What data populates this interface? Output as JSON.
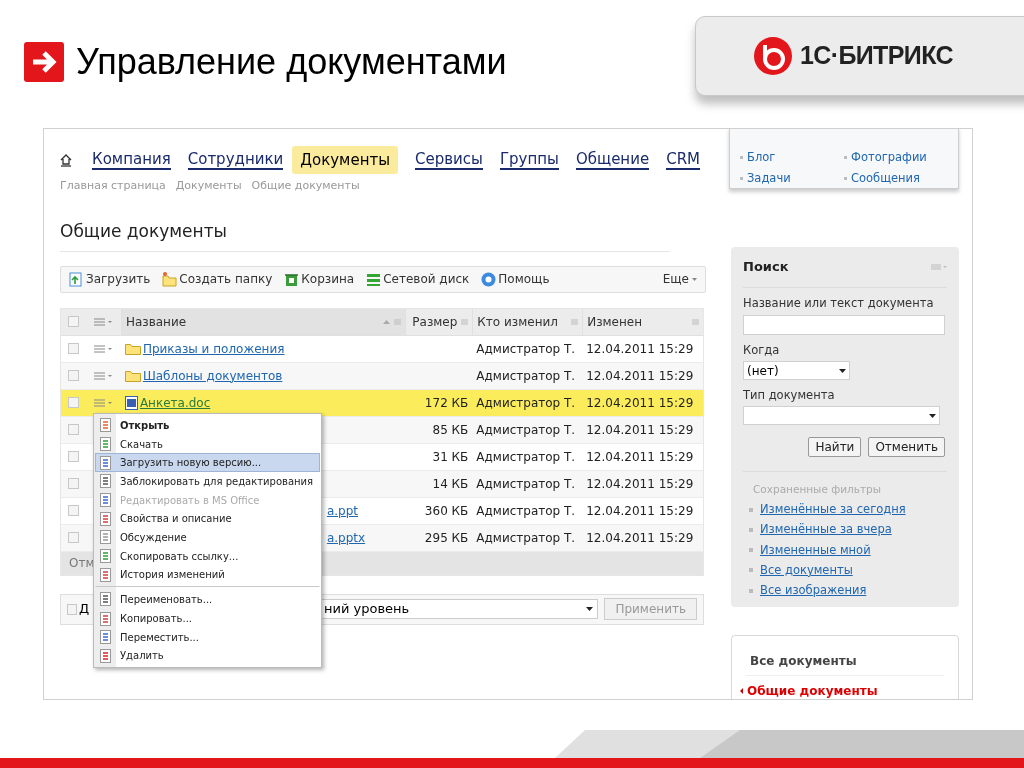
{
  "slide": {
    "title": "Управление документами",
    "logo_text": "1С·БИТРИКС"
  },
  "nav": [
    {
      "label": "Компания",
      "selected": false
    },
    {
      "label": "Сотрудники",
      "selected": false
    },
    {
      "label": "Документы",
      "selected": true
    },
    {
      "label": "Сервисы",
      "selected": false
    },
    {
      "label": "Группы",
      "selected": false
    },
    {
      "label": "Общение",
      "selected": false
    },
    {
      "label": "CRM",
      "selected": false
    }
  ],
  "breadcrumb": [
    "Главная страница",
    "Документы",
    "Общие документы"
  ],
  "page_title": "Общие документы",
  "toolbar": {
    "items": [
      "Загрузить",
      "Создать папку",
      "Корзина",
      "Сетевой диск",
      "Помощь"
    ],
    "more": "Еще"
  },
  "table": {
    "all_checked": false,
    "columns": [
      {
        "label": "Название"
      },
      {
        "label": "Размер"
      },
      {
        "label": "Кто изменил"
      },
      {
        "label": "Изменен"
      }
    ],
    "rows": [
      {
        "kind": "folder",
        "name": "Приказы и положения",
        "size": "",
        "author": "Адмистратор Т.",
        "modified": "12.04.2011 15:29",
        "selected": false,
        "checked": false
      },
      {
        "kind": "folder",
        "name": "Шаблоны документов",
        "size": "",
        "author": "Адмистратор Т.",
        "modified": "12.04.2011 15:29",
        "selected": false,
        "checked": false
      },
      {
        "kind": "doc",
        "name": "Анкета.doc",
        "size": "172 КБ",
        "author": "Адмистратор Т.",
        "modified": "12.04.2011 15:29",
        "selected": true,
        "checked": false
      },
      {
        "kind": "hidden",
        "size": "85 КБ",
        "author": "Адмистратор Т.",
        "modified": "12.04.2011 15:29",
        "selected": false,
        "checked": false
      },
      {
        "kind": "hidden",
        "size": "31 КБ",
        "author": "Адмистратор Т.",
        "modified": "12.04.2011 15:29",
        "selected": false,
        "checked": false
      },
      {
        "kind": "hidden",
        "size": "14 КБ",
        "author": "Адмистратор Т.",
        "modified": "12.04.2011 15:29",
        "selected": false,
        "checked": false
      },
      {
        "kind": "partial",
        "name": "а.ppt",
        "size": "360 КБ",
        "author": "Адмистратор Т.",
        "modified": "12.04.2011 15:29",
        "selected": false,
        "checked": false
      },
      {
        "kind": "partial",
        "name": "а.pptx",
        "size": "295 КБ",
        "author": "Адмистратор Т.",
        "modified": "12.04.2011 15:29",
        "selected": false,
        "checked": false
      }
    ],
    "footer_text": "Отм"
  },
  "action_bar": {
    "checkbox_label": "Д",
    "checked": false,
    "select_value": "ний уровень",
    "apply_button": "Применить"
  },
  "context_menu": [
    {
      "label": "Открыть",
      "default": true,
      "disabled": false,
      "selected": false,
      "separator_before": false
    },
    {
      "label": "Скачать",
      "default": false,
      "disabled": false,
      "selected": false,
      "separator_before": false
    },
    {
      "label": "Загрузить новую версию...",
      "default": false,
      "disabled": false,
      "selected": true,
      "separator_before": false
    },
    {
      "label": "Заблокировать для редактирования",
      "default": false,
      "disabled": false,
      "selected": false,
      "separator_before": false
    },
    {
      "label": "Редактировать в MS Office",
      "default": false,
      "disabled": true,
      "selected": false,
      "separator_before": false
    },
    {
      "label": "Свойства и описание",
      "default": false,
      "disabled": false,
      "selected": false,
      "separator_before": false
    },
    {
      "label": "Обсуждение",
      "default": false,
      "disabled": false,
      "selected": false,
      "separator_before": false
    },
    {
      "label": "Скопировать ссылку...",
      "default": false,
      "disabled": false,
      "selected": false,
      "separator_before": false
    },
    {
      "label": "История изменений",
      "default": false,
      "disabled": false,
      "selected": false,
      "separator_before": false
    },
    {
      "label": "Переименовать...",
      "default": false,
      "disabled": false,
      "selected": false,
      "separator_before": true
    },
    {
      "label": "Копировать...",
      "default": false,
      "disabled": false,
      "selected": false,
      "separator_before": false
    },
    {
      "label": "Переместить...",
      "default": false,
      "disabled": false,
      "selected": false,
      "separator_before": false
    },
    {
      "label": "Удалить",
      "default": false,
      "disabled": false,
      "selected": false,
      "separator_before": false
    }
  ],
  "quick_links": [
    "Блог",
    "Фотографии",
    "Задачи",
    "Сообщения"
  ],
  "search": {
    "title": "Поиск",
    "fields": [
      {
        "kind": "text",
        "label": "Название или текст документа"
      },
      {
        "kind": "select",
        "label": "Когда",
        "value": "(нет)"
      },
      {
        "kind": "select",
        "label": "Тип документа"
      }
    ],
    "buttons": [
      "Найти",
      "Отменить"
    ],
    "saved_filters_title": "Сохраненные фильтры",
    "saved_filters": [
      "Изменённые за сегодня",
      "Изменённые за вчера",
      "Измененные мной",
      "Все документы",
      "Все изображения"
    ]
  },
  "sections": [
    {
      "label": "Все документы",
      "selected": false
    },
    {
      "label": "Общие документы",
      "selected": true
    }
  ]
}
